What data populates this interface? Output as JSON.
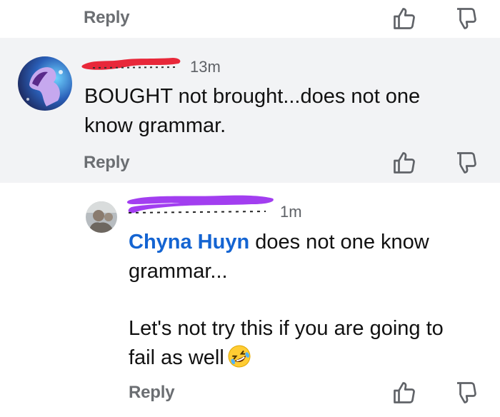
{
  "top_action": {
    "reply_label": "Reply"
  },
  "comment_1": {
    "time": "13m",
    "text_line1": "BOUGHT not brought...does not one",
    "text_line2": "know grammar.",
    "reply_label": "Reply"
  },
  "comment_2": {
    "time": "1m",
    "mention": "Chyna Huyn",
    "text_line1_rest": " does not one know",
    "text_line2": "grammar...",
    "text_line3": "Let's not try this if you are going to",
    "text_line4": "fail as well",
    "emoji": "rolling-on-floor-laughing",
    "reply_label": "Reply"
  },
  "colors": {
    "mention": "#1464d2",
    "redact_red": "#e8283a",
    "redact_purple": "#a23ef0",
    "highlight_bg": "#f2f3f5"
  },
  "icons": [
    "thumbs-up-icon",
    "thumbs-down-icon"
  ]
}
